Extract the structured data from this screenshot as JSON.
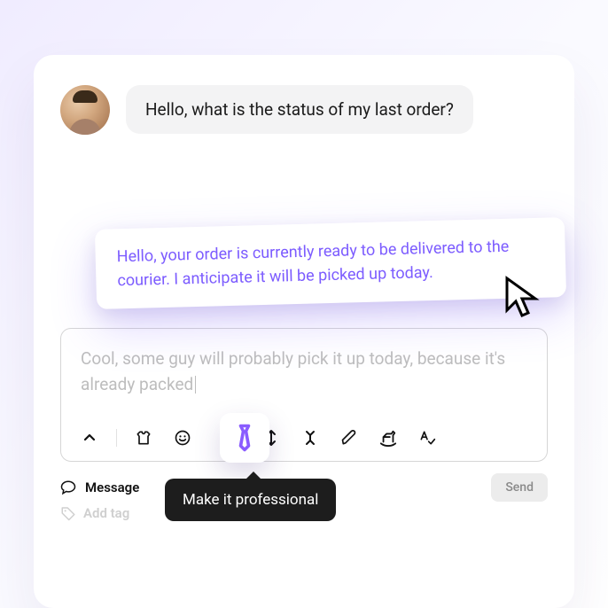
{
  "conversation": {
    "user_message": "Hello, what is the status of my last order?",
    "agent_suggestion": "Hello, your order is currently ready to be delivered to the courier. I anticipate it will be picked up today."
  },
  "composer": {
    "draft_text": "Cool, some guy will probably pick it up today, because it's already packed"
  },
  "toolbar": {
    "active_icon": "tie-icon"
  },
  "tooltip": {
    "text": "Make it professional"
  },
  "footer": {
    "message_label": "Message",
    "send_label": "Send"
  },
  "tag": {
    "add_tag_label": "Add tag"
  }
}
